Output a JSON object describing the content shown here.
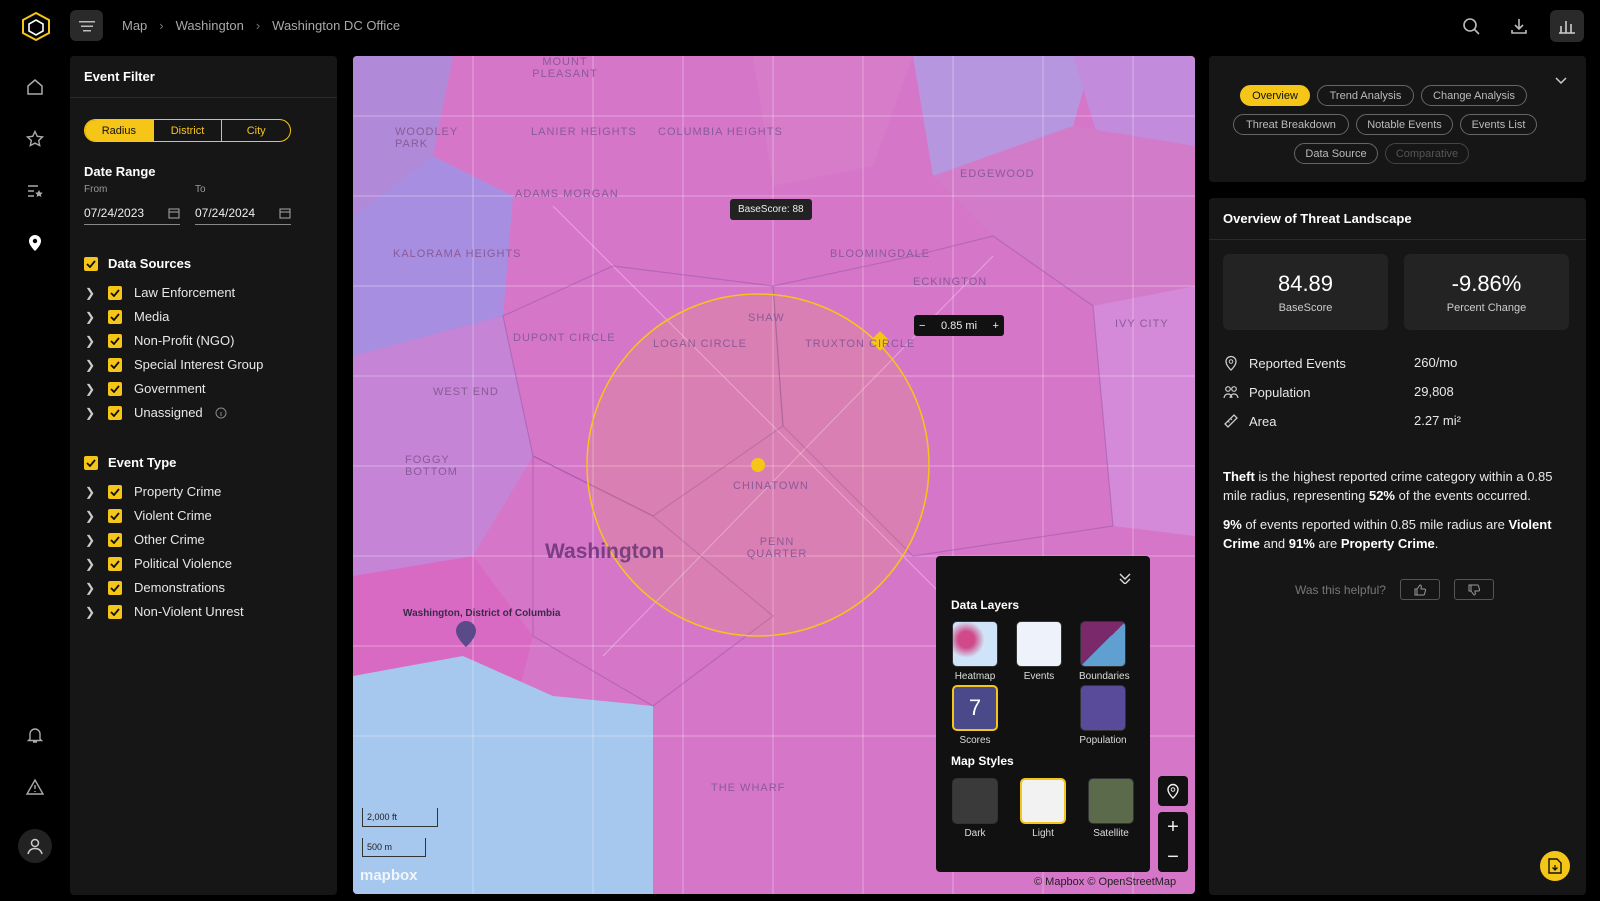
{
  "breadcrumb": [
    "Map",
    "Washington",
    "Washington DC Office"
  ],
  "filter": {
    "title": "Event Filter",
    "segments": [
      "Radius",
      "District",
      "City"
    ],
    "date_range_title": "Date Range",
    "from_label": "From",
    "to_label": "To",
    "from_value": "07/24/2023",
    "to_value": "07/24/2024",
    "data_sources_title": "Data Sources",
    "data_sources": [
      "Law Enforcement",
      "Media",
      "Non-Profit (NGO)",
      "Special Interest Group",
      "Government",
      "Unassigned"
    ],
    "event_type_title": "Event Type",
    "event_types": [
      "Property Crime",
      "Violent Crime",
      "Other Crime",
      "Political Violence",
      "Demonstrations",
      "Non-Violent Unrest"
    ]
  },
  "tabs": [
    "Overview",
    "Trend Analysis",
    "Change Analysis",
    "Threat Breakdown",
    "Notable Events",
    "Events List",
    "Data Source",
    "Comparative"
  ],
  "overview": {
    "title": "Overview of Threat Landscape",
    "basescore_value": "84.89",
    "basescore_label": "BaseScore",
    "change_value": "-9.86%",
    "change_label": "Percent Change",
    "stats": [
      {
        "label": "Reported Events",
        "value": "260/mo"
      },
      {
        "label": "Population",
        "value": "29,808"
      },
      {
        "label": "Area",
        "value": "2.27 mi²"
      }
    ],
    "p1_a": "Theft",
    "p1_b": " is the highest reported crime category within a 0.85 mile radius, representing ",
    "p1_c": "52%",
    "p1_d": " of the events occurred.",
    "p2_a": "9%",
    "p2_b": " of events reported within 0.85 mile radius are ",
    "p2_c": "Violent Crime",
    "p2_d": " and ",
    "p2_e": "91%",
    "p2_f": " are ",
    "p2_g": "Property Crime",
    "p2_h": ".",
    "helpful": "Was this helpful?"
  },
  "map": {
    "tooltip": "BaseScore: 88",
    "radius": "0.85 mi",
    "place_label": "Washington",
    "pin_label": "Washington, District of Columbia",
    "scale_ft": "2,000 ft",
    "scale_m": "500 m",
    "attribution": "© Mapbox  © OpenStreetMap",
    "logo": "mapbox",
    "labels": [
      "MOUNT PLEASANT",
      "LANIER HEIGHTS",
      "COLUMBIA HEIGHTS",
      "ADAMS MORGAN",
      "KALORAMA HEIGHTS",
      "DUPONT CIRCLE",
      "LOGAN CIRCLE",
      "SHAW",
      "TRUXTON CIRCLE",
      "BLOOMINGDALE",
      "ECKINGTON",
      "EDGEWOOD",
      "WEST END",
      "FOGGY BOTTOM",
      "CHINATOWN",
      "PENN QUARTER",
      "THE WHARF",
      "IVY CITY",
      "WOODLEY PARK"
    ],
    "color_boundary": "#e05fb8",
    "color_accent": "#f5c518"
  },
  "layers": {
    "data_title": "Data Layers",
    "items": [
      "Heatmap",
      "Events",
      "Boundaries",
      "Scores",
      "Population"
    ],
    "score_value": "7",
    "styles_title": "Map Styles",
    "styles": [
      "Dark",
      "Light",
      "Satellite"
    ]
  }
}
